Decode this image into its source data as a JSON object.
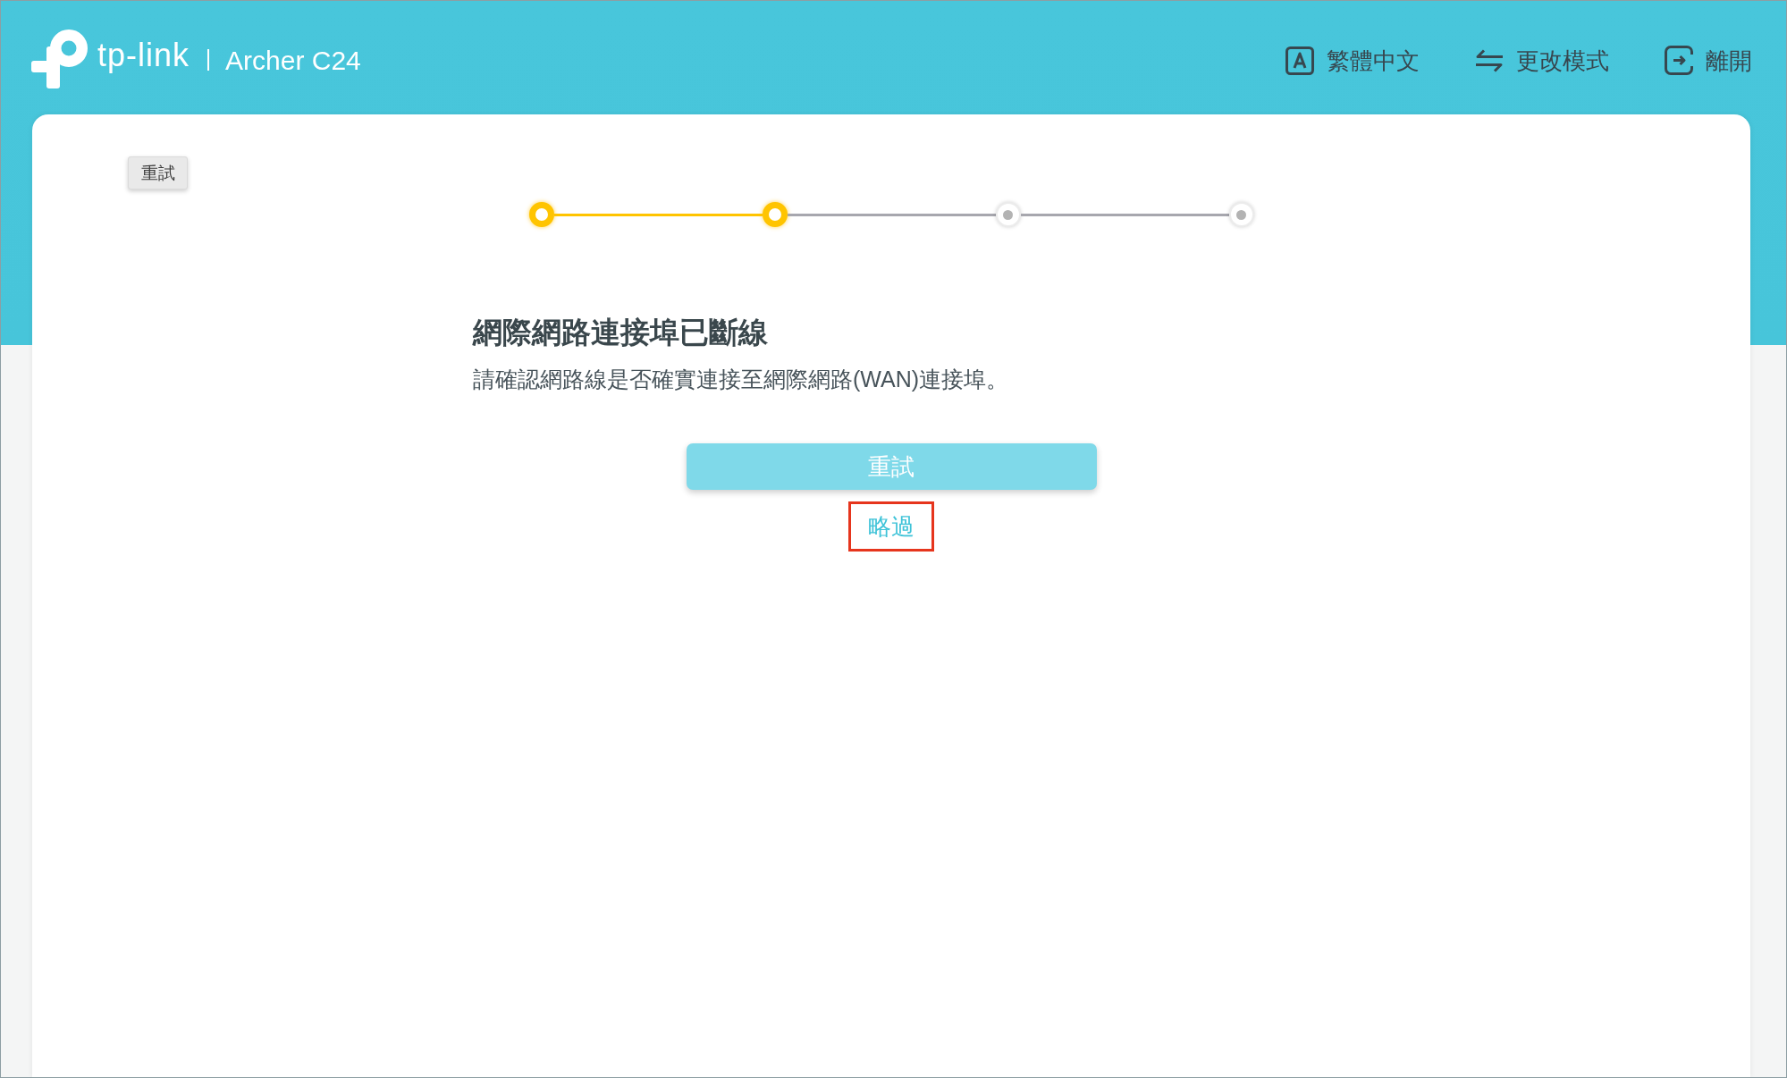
{
  "header": {
    "logo": "tp-link",
    "model": "Archer C24",
    "actions": [
      {
        "kind": "language",
        "label": "繁體中文"
      },
      {
        "kind": "mode",
        "label": "更改模式"
      },
      {
        "kind": "logout",
        "label": "離開"
      }
    ]
  },
  "tooltip": {
    "text": "重試"
  },
  "stepper": {
    "steps": [
      {
        "active": true
      },
      {
        "active": true
      },
      {
        "active": false
      },
      {
        "active": false
      }
    ]
  },
  "message": {
    "title": "網際網路連接埠已斷線",
    "description": "請確認網路線是否確實連接至網際網路(WAN)連接埠。"
  },
  "retry_button": {
    "label": "重試"
  },
  "skip_link": {
    "label": "略過",
    "highlighted": true
  }
}
